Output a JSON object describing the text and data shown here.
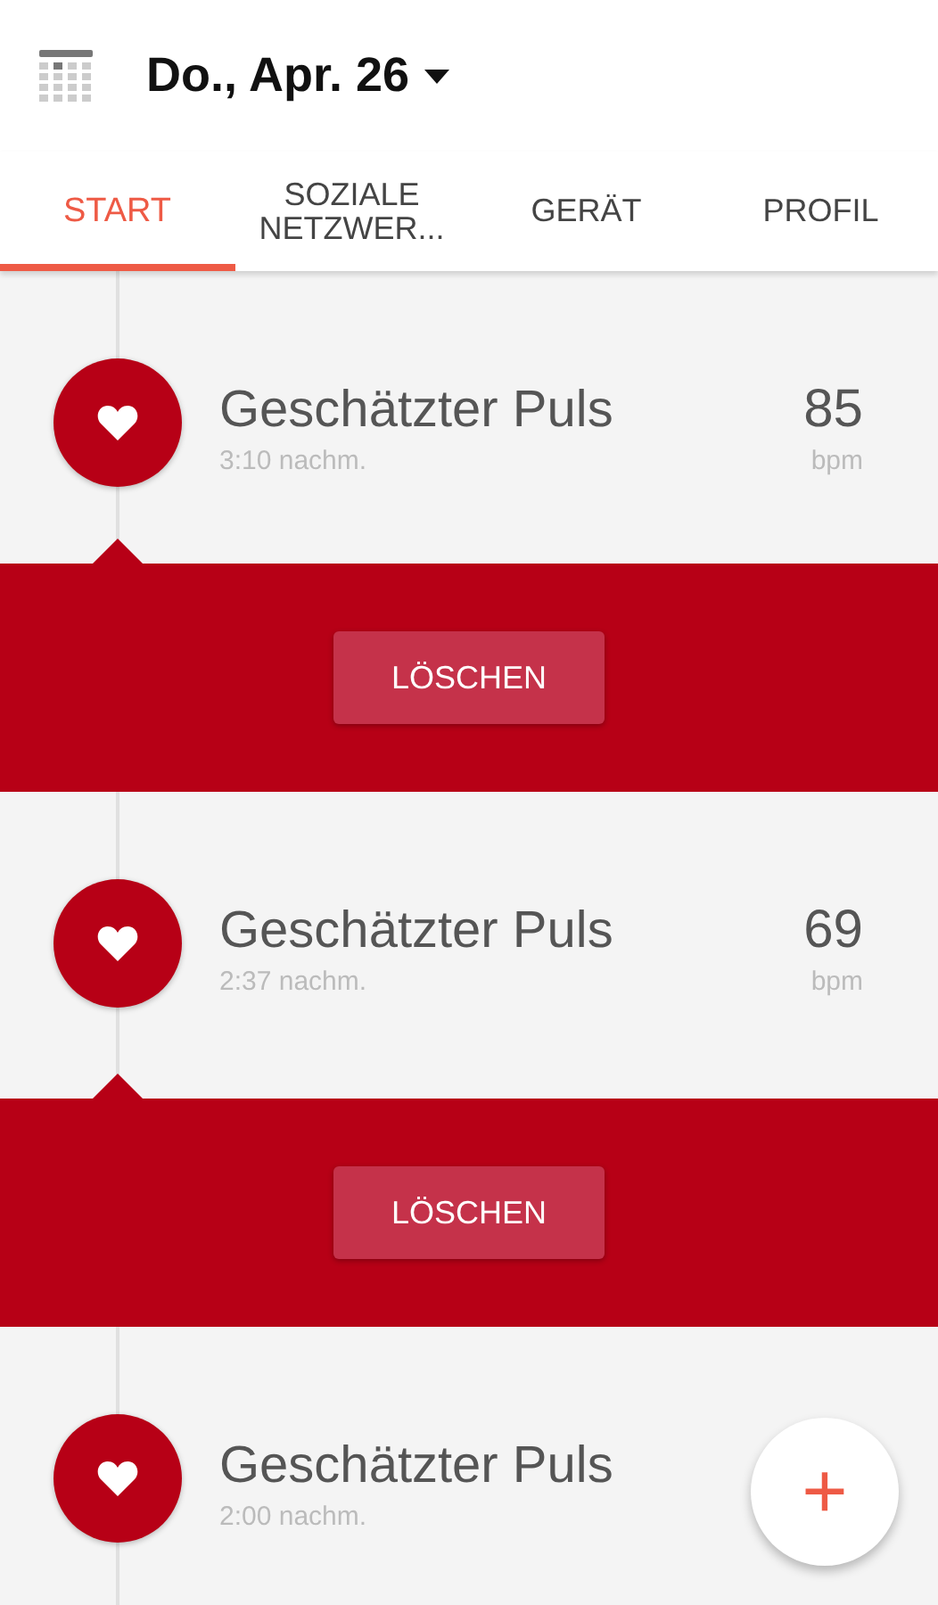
{
  "header": {
    "date": "Do., Apr. 26"
  },
  "tabs": [
    {
      "label": "START",
      "selected": true
    },
    {
      "label": "SOZIALE NETZWER...",
      "selected": false
    },
    {
      "label": "GERÄT",
      "selected": false
    },
    {
      "label": "PROFIL",
      "selected": false
    }
  ],
  "entries": [
    {
      "title": "Geschätzter Puls",
      "time": "3:10 nachm.",
      "value": "85",
      "unit": "bpm",
      "expanded": true,
      "action": "LÖSCHEN"
    },
    {
      "title": "Geschätzter Puls",
      "time": "2:37 nachm.",
      "value": "69",
      "unit": "bpm",
      "expanded": true,
      "action": "LÖSCHEN"
    },
    {
      "title": "Geschätzter Puls",
      "time": "2:00 nachm.",
      "expanded": false
    }
  ],
  "fab": {
    "label": "+"
  }
}
